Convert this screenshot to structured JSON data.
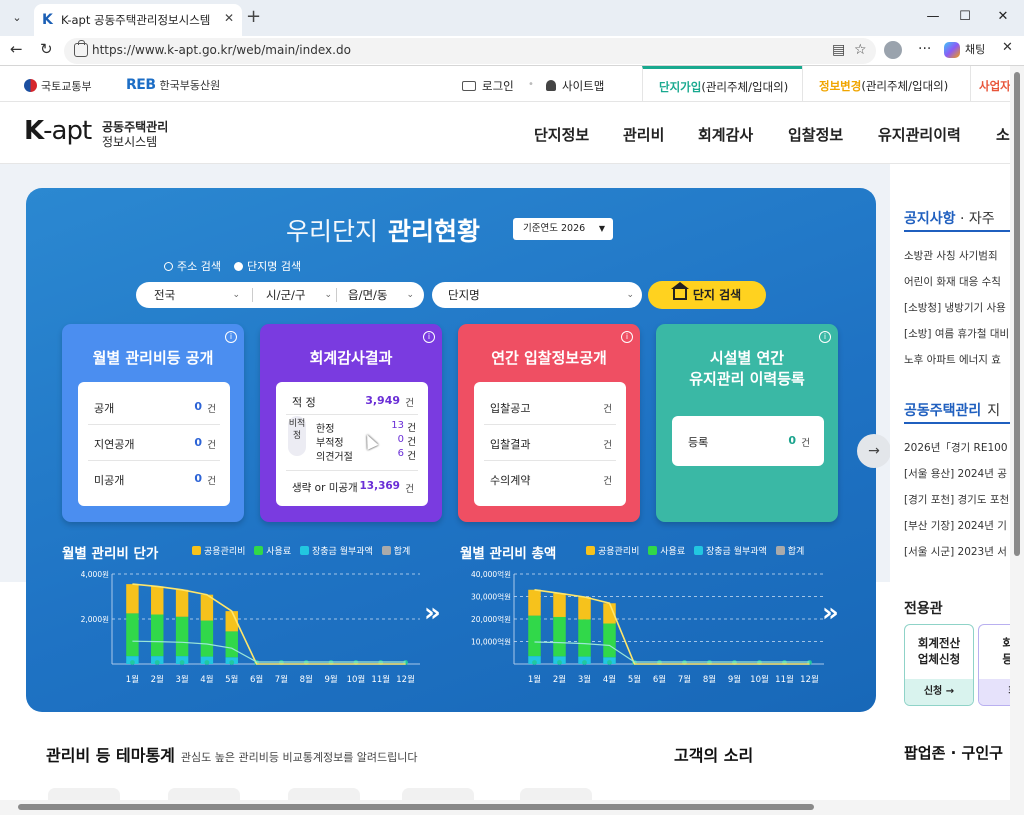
{
  "browser": {
    "tab_title": "K-apt 공동주택관리정보시스템",
    "favicon": "K",
    "url": "https://www.k-apt.go.kr/web/main/index.do",
    "copilot_label": "채팅"
  },
  "header": {
    "gov1": "국토교통부",
    "gov2_logo": "REB",
    "gov2": "한국부동산원",
    "login": "로그인",
    "sitemap": "사이트맵",
    "tab1_a": "단지가입",
    "tab1_b": "(관리주체/입대의)",
    "tab2_a": "정보변경",
    "tab2_b": "(관리주체/입대의)",
    "tab3": "사업자",
    "logo_k": "K",
    "logo_apt": "-apt",
    "logo_line1": "공동주택관리",
    "logo_line2": "정보시스템",
    "menu": [
      "단지정보",
      "관리비",
      "회계감사",
      "입찰정보",
      "유지관리이력",
      "소"
    ]
  },
  "panel": {
    "title_a": "우리단지",
    "title_b": "관리현황",
    "year_label": "기준연도 2026",
    "radio_address": "주소 검색",
    "radio_name": "단지명 검색",
    "sel_sido": "전국",
    "sel_sigungu": "시/군/구",
    "sel_eupmyeon": "읍/면/동",
    "sel_complex": "단지명",
    "search_btn": "단지 검색",
    "info": "i"
  },
  "cards": {
    "c1": {
      "title": "월별 관리비등 공개",
      "rows": [
        {
          "label": "공개",
          "value": "0",
          "unit": "건"
        },
        {
          "label": "지연공개",
          "value": "0",
          "unit": "건"
        },
        {
          "label": "미공개",
          "value": "0",
          "unit": "건"
        }
      ]
    },
    "c2": {
      "title": "회계감사결과",
      "proper_label": "적 정",
      "proper_value": "3,949",
      "unit": "건",
      "bi_label": "비적정",
      "bi_rows": [
        {
          "label": "한정",
          "value": "13"
        },
        {
          "label": "부적정",
          "value": "0"
        },
        {
          "label": "의견거절",
          "value": "6"
        }
      ],
      "omit_label": "생략 or 미공개",
      "omit_value": "13,369"
    },
    "c3": {
      "title": "연간 입찰정보공개",
      "rows": [
        {
          "label": "입찰공고",
          "unit": "건"
        },
        {
          "label": "입찰결과",
          "unit": "건"
        },
        {
          "label": "수의계약",
          "unit": "건"
        }
      ]
    },
    "c4": {
      "title_line1": "시설별 연간",
      "title_line2": "유지관리 이력등록",
      "row_label": "등록",
      "row_value": "0",
      "row_unit": "건"
    }
  },
  "charts": {
    "left_title": "월별 관리비 단가",
    "right_title": "월별 관리비 총액",
    "legend": [
      "공용관리비",
      "사용료",
      "장충금 월부과액",
      "합계"
    ],
    "legend_colors": [
      "#f6c21c",
      "#31d84a",
      "#22c7e0",
      "#aaaaaa"
    ]
  },
  "chart_data": [
    {
      "type": "bar",
      "title": "월별 관리비 단가",
      "categories": [
        "1월",
        "2월",
        "3월",
        "4월",
        "5월",
        "6월",
        "7월",
        "8월",
        "9월",
        "10월",
        "11월",
        "12월"
      ],
      "ylim": [
        0,
        4000
      ],
      "yticks": [
        "4,000원",
        "2,000원"
      ],
      "series": [
        {
          "name": "공용관리비",
          "values": [
            1300,
            1250,
            1200,
            1150,
            900,
            0,
            0,
            0,
            0,
            0,
            0,
            0
          ]
        },
        {
          "name": "사용료",
          "values": [
            1900,
            1850,
            1750,
            1600,
            1150,
            0,
            0,
            0,
            0,
            0,
            0,
            0
          ]
        },
        {
          "name": "장충금 월부과액",
          "values": [
            350,
            350,
            350,
            330,
            300,
            0,
            0,
            0,
            0,
            0,
            0,
            0
          ]
        },
        {
          "name": "합계",
          "values": [
            3550,
            3450,
            3300,
            3080,
            2350,
            0,
            0,
            0,
            0,
            0,
            0,
            0
          ]
        }
      ]
    },
    {
      "type": "bar",
      "title": "월별 관리비 총액",
      "categories": [
        "1월",
        "2월",
        "3월",
        "4월",
        "5월",
        "6월",
        "7월",
        "8월",
        "9월",
        "10월",
        "11월",
        "12월"
      ],
      "ylim": [
        0,
        40000
      ],
      "yticks": [
        "40,000억원",
        "30,000억원",
        "20,000억원",
        "10,000억원"
      ],
      "series": [
        {
          "name": "공용관리비",
          "values": [
            11500,
            10500,
            10000,
            9000,
            0,
            0,
            0,
            0,
            0,
            0,
            0,
            0
          ]
        },
        {
          "name": "사용료",
          "values": [
            18000,
            17500,
            16500,
            15000,
            0,
            0,
            0,
            0,
            0,
            0,
            0,
            0
          ]
        },
        {
          "name": "장충금 월부과액",
          "values": [
            3500,
            3400,
            3300,
            3000,
            0,
            0,
            0,
            0,
            0,
            0,
            0,
            0
          ]
        },
        {
          "name": "합계",
          "values": [
            33000,
            31400,
            29800,
            27000,
            0,
            0,
            0,
            0,
            0,
            0,
            0,
            0
          ]
        }
      ]
    }
  ],
  "sidebar": {
    "notice_h": "공지사항",
    "notice_sub": "자주",
    "notices": [
      "소방관 사칭 사기범죄",
      "어린이 화재 대응 수칙",
      "[소방청] 냉방기기 사용",
      "[소방] 여름 휴가철 대비",
      "노후 아파트 에너지 효"
    ],
    "news_h": "공동주택관리",
    "news_sub": "지",
    "news": [
      "2026년「경기 RE100",
      "[서울 용산] 2024년 공",
      "[경기 포천] 경기도 포천",
      "[부산 기장] 2024년 기",
      "[서울 시군] 2023년 서"
    ],
    "exclusive_h": "전용관",
    "card1_l1": "회계전산",
    "card1_l2": "업체신청",
    "card1_btn": "신청 →",
    "card2_l1": "회계",
    "card2_l2": "등록",
    "card2_btn": "회"
  },
  "bottom": {
    "theme_h": "관리비 등 테마통계",
    "theme_sub": "관심도 높은 관리비등 비교통계정보를 알려드립니다",
    "voice_h": "고객의 소리",
    "popup_h": "팝업존 · 구인구"
  }
}
